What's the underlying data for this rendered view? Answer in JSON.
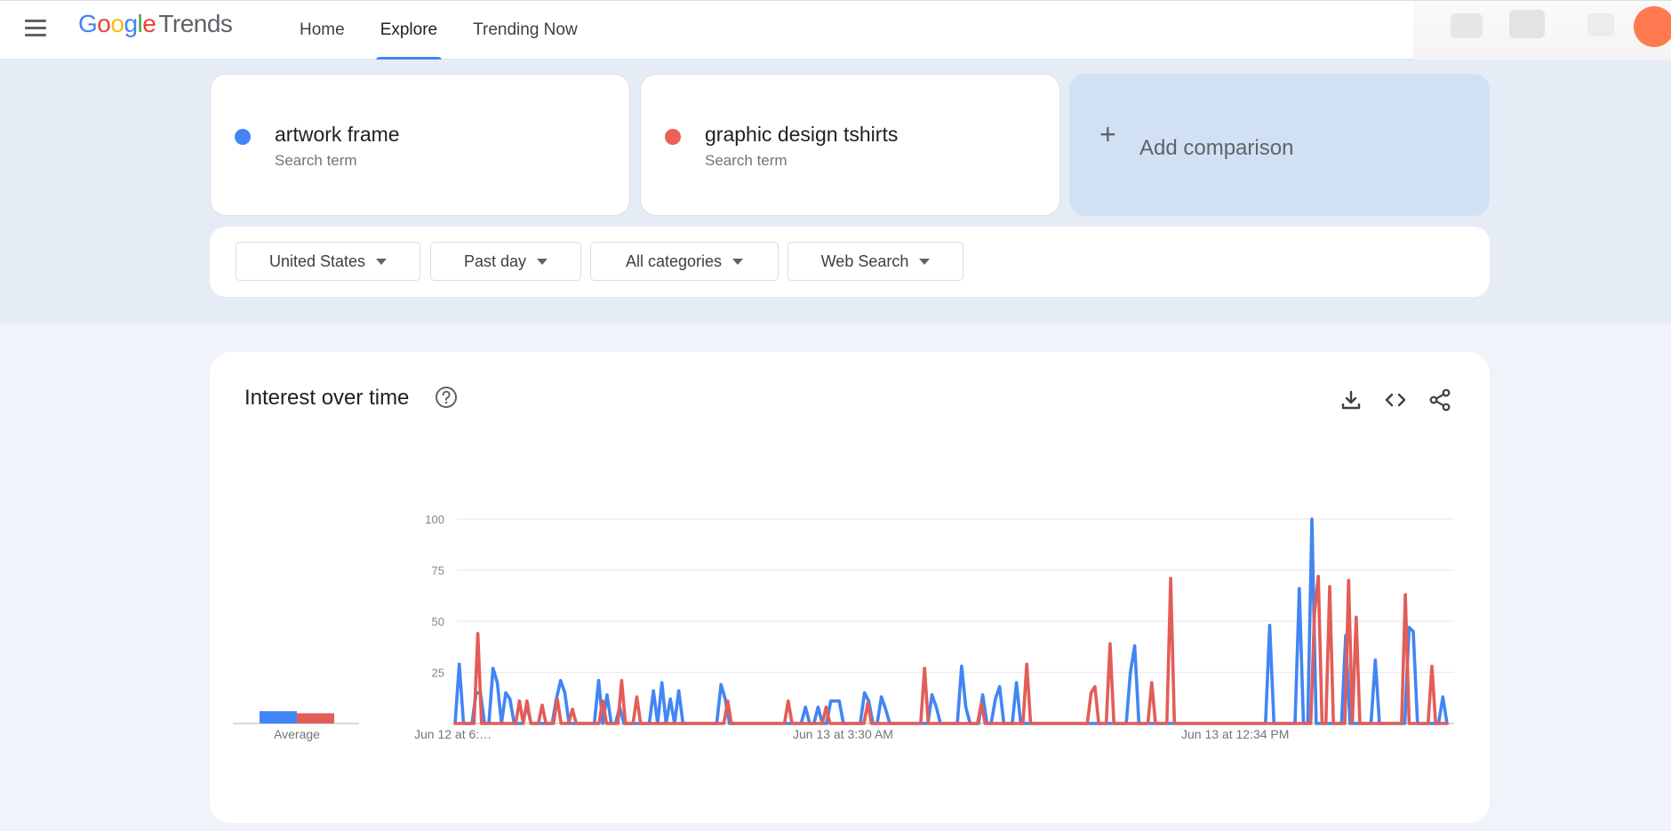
{
  "header": {
    "logo": {
      "g1": "G",
      "g2": "o",
      "g3": "o",
      "g4": "g",
      "g5": "l",
      "g6": "e",
      "product": "Trends"
    },
    "nav": [
      {
        "label": "Home",
        "active": false
      },
      {
        "label": "Explore",
        "active": true
      },
      {
        "label": "Trending Now",
        "active": false
      }
    ]
  },
  "terms": [
    {
      "name": "artwork frame",
      "type": "Search term",
      "color": "#4285f4"
    },
    {
      "name": "graphic design tshirts",
      "type": "Search term",
      "color": "#ea6159"
    }
  ],
  "add_comparison": {
    "label": "Add comparison",
    "icon": "plus-icon"
  },
  "filters": [
    {
      "label": "United States"
    },
    {
      "label": "Past day"
    },
    {
      "label": "All categories"
    },
    {
      "label": "Web Search"
    }
  ],
  "interest_card": {
    "title": "Interest over time",
    "icons": [
      "help-icon",
      "download-icon",
      "embed-code-icon",
      "share-icon"
    ]
  },
  "chart_data": {
    "type": "line",
    "y_ticks": [
      "25",
      "50",
      "75",
      "100"
    ],
    "ylim": [
      0,
      100
    ],
    "x_tick_labels": [
      "Jun 12 at 6:…",
      "Jun 13 at 3:30 AM",
      "Jun 13 at 12:34 PM"
    ],
    "average_label": "Average",
    "averages": [
      6,
      5
    ],
    "series": [
      {
        "name": "artwork frame",
        "color": "#4285f4",
        "values": [
          0,
          29,
          0,
          0,
          0,
          15,
          15,
          0,
          0,
          27,
          20,
          0,
          15,
          12,
          0,
          0,
          0,
          9,
          0,
          0,
          0,
          0,
          0,
          0,
          12,
          21,
          15,
          0,
          0,
          0,
          0,
          0,
          0,
          0,
          21,
          0,
          14,
          0,
          0,
          8,
          0,
          0,
          0,
          0,
          0,
          0,
          0,
          16,
          0,
          20,
          0,
          12,
          0,
          16,
          0,
          0,
          0,
          0,
          0,
          0,
          0,
          0,
          0,
          19,
          12,
          0,
          0,
          0,
          0,
          0,
          0,
          0,
          0,
          0,
          0,
          0,
          0,
          0,
          0,
          0,
          0,
          0,
          0,
          8,
          0,
          0,
          8,
          0,
          0,
          11,
          11,
          11,
          0,
          0,
          0,
          0,
          0,
          15,
          11,
          0,
          0,
          13,
          7,
          0,
          0,
          0,
          0,
          0,
          0,
          0,
          0,
          0,
          0,
          14,
          8,
          0,
          0,
          0,
          0,
          0,
          28,
          8,
          0,
          0,
          0,
          14,
          0,
          0,
          12,
          18,
          0,
          0,
          0,
          20,
          0,
          0,
          0,
          0,
          0,
          0,
          0,
          0,
          0,
          0,
          0,
          0,
          0,
          0,
          0,
          0,
          0,
          0,
          0,
          0,
          0,
          0,
          0,
          0,
          0,
          0,
          25,
          38,
          0,
          0,
          0,
          0,
          0,
          0,
          0,
          0,
          0,
          0,
          0,
          0,
          0,
          0,
          0,
          0,
          0,
          0,
          0,
          0,
          0,
          0,
          0,
          0,
          0,
          0,
          0,
          0,
          0,
          0,
          0,
          48,
          0,
          0,
          0,
          0,
          0,
          0,
          66,
          0,
          0,
          100,
          0,
          0,
          0,
          0,
          0,
          0,
          0,
          43,
          0,
          0,
          0,
          0,
          0,
          0,
          31,
          0,
          0,
          0,
          0,
          0,
          0,
          0,
          47,
          45,
          0,
          0,
          0,
          0,
          0,
          0,
          13,
          0
        ],
        "line_width": 4
      },
      {
        "name": "graphic design tshirts",
        "color": "#e35d57",
        "values": [
          0,
          0,
          0,
          0,
          0,
          0,
          44,
          0,
          0,
          0,
          0,
          0,
          0,
          0,
          0,
          0,
          0,
          11,
          0,
          11,
          0,
          0,
          0,
          9,
          0,
          0,
          0,
          12,
          0,
          0,
          0,
          7,
          0,
          0,
          0,
          0,
          0,
          0,
          0,
          11,
          0,
          0,
          0,
          0,
          21,
          0,
          0,
          0,
          13,
          0,
          0,
          0,
          0,
          0,
          0,
          0,
          0,
          0,
          0,
          0,
          0,
          0,
          0,
          0,
          0,
          0,
          0,
          0,
          0,
          0,
          0,
          0,
          11,
          0,
          0,
          0,
          0,
          0,
          0,
          0,
          0,
          0,
          0,
          0,
          0,
          0,
          0,
          0,
          11,
          0,
          0,
          0,
          0,
          0,
          0,
          0,
          0,
          0,
          8,
          0,
          0,
          0,
          0,
          0,
          0,
          0,
          0,
          0,
          0,
          10,
          0,
          0,
          0,
          0,
          0,
          0,
          0,
          0,
          0,
          0,
          0,
          0,
          0,
          0,
          27,
          0,
          0,
          0,
          0,
          0,
          0,
          0,
          0,
          0,
          0,
          0,
          0,
          0,
          0,
          10,
          0,
          0,
          0,
          0,
          0,
          0,
          0,
          0,
          0,
          0,
          0,
          29,
          0,
          0,
          0,
          0,
          0,
          0,
          0,
          0,
          0,
          0,
          0,
          0,
          0,
          0,
          0,
          0,
          15,
          18,
          0,
          0,
          0,
          39,
          0,
          0,
          0,
          0,
          0,
          0,
          0,
          0,
          0,
          0,
          20,
          0,
          0,
          0,
          0,
          71,
          0,
          0,
          0,
          0,
          0,
          0,
          0,
          0,
          0,
          0,
          0,
          0,
          0,
          0,
          0,
          0,
          0,
          0,
          0,
          0,
          0,
          0,
          0,
          0,
          0,
          0,
          0,
          0,
          0,
          0,
          0,
          0,
          0,
          0,
          0,
          0,
          0,
          54,
          72,
          0,
          0,
          67,
          0,
          0,
          0,
          0,
          70,
          0,
          52,
          0,
          0,
          0,
          0,
          0,
          0,
          0,
          0,
          0,
          0,
          0,
          0,
          63,
          0,
          0,
          0,
          0,
          0,
          0,
          28,
          0,
          0,
          0,
          0
        ],
        "line_width": 4
      }
    ]
  }
}
